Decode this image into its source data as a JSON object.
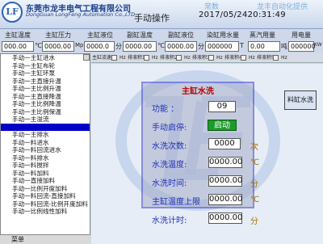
{
  "header": {
    "logo_text": "LF",
    "company_cn": "东莞市龙丰电气工程有限公司",
    "company_en": "DongGuan LongFeng Automation Co.,LTD",
    "page_title": "手动操作",
    "tag_left": "常数",
    "tag_right": "龙丰自动化提供",
    "datetime": "2017/05/2420:31:49"
  },
  "readouts": [
    {
      "label": "主缸温度",
      "value": "000.00",
      "unit": "℃"
    },
    {
      "label": "主缸压力",
      "value": "0000.00",
      "unit": "Mpa"
    },
    {
      "label": "主缸液位",
      "value": "0000.0",
      "unit": "分"
    },
    {
      "label": "副缸温度",
      "value": "0000.00",
      "unit": "℃"
    },
    {
      "label": "副缸液位",
      "value": "0000.00",
      "unit": "分"
    },
    {
      "label": "染缸用水量",
      "value": "000000",
      "unit": "T"
    },
    {
      "label": "蒸汽用量",
      "value": "0.00",
      "unit": "吨"
    },
    {
      "label": "用电量",
      "value": "000000",
      "unit": "KW"
    }
  ],
  "menu": {
    "items": [
      "手动一主缸进水",
      "手动一主缸布轮",
      "手动一主缸环泵",
      "手动一主直接升温",
      "手动一主比例升温",
      "手动一主直接降温",
      "手动一主比例降温",
      "手动一主比例保温",
      "手动一主溢流",
      "",
      "手动一主排水",
      "手动一料进水",
      "手动一料回流进水",
      "手动一料排水",
      "手动一料搅拌",
      "手动一料加料",
      "手动一直接加料",
      "手动一比例开度加料",
      "手动一料回流-直接加料",
      "手动一料回流-比例开度加料",
      "手动一比例线性加料"
    ],
    "selected_index": 9,
    "footer": "菜单"
  },
  "channels": [
    "主缸流速",
    "Hz",
    "排液积1",
    "Hz",
    "排液积2",
    "Hz",
    "排液积3",
    "Hz",
    "排液积4",
    "Hz",
    "排液积5",
    "Hz"
  ],
  "panel": {
    "title": "主缸水洗",
    "function_label": "功能 ：",
    "function_value": "09",
    "start_label": "手动启停:",
    "start_button": "启动",
    "rows": [
      {
        "label": "水洗次数:",
        "value": "0000",
        "unit": "次"
      },
      {
        "label": "水洗温度:",
        "value": "0000.00",
        "unit": "℃"
      },
      {
        "label": "水洗时间:",
        "value": "0000.00",
        "unit": "分"
      },
      {
        "label": "主缸温度上限",
        "value": "0000.00",
        "unit": "℃"
      },
      {
        "label": "水洗计时:",
        "value": "0000.00",
        "unit": "分"
      }
    ]
  },
  "wash_button": "料缸水洗",
  "colors": {
    "accent": "#0000c8",
    "panel_border": "#3c3ccf",
    "start_green": "#1d9b2a",
    "title_red": "#b40000"
  }
}
